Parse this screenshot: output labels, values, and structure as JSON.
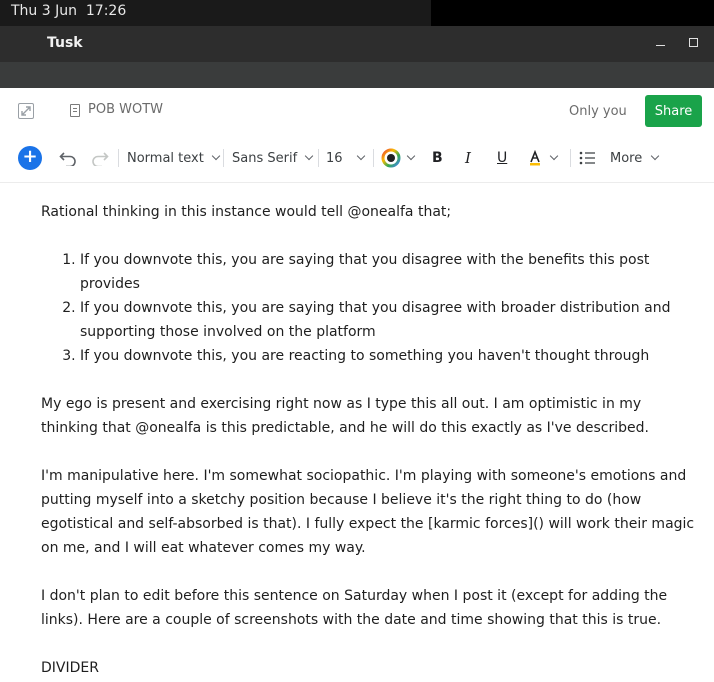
{
  "system": {
    "datetime": "Thu 3 Jun  17:26"
  },
  "window": {
    "title": "Tusk"
  },
  "header": {
    "doc_title": "POB WOTW",
    "visibility": "Only you",
    "share_label": "Share"
  },
  "toolbar": {
    "paragraph_style": "Normal text",
    "font_family": "Sans Serif",
    "font_size": "16",
    "bold": "B",
    "italic": "I",
    "underline": "U",
    "more": "More",
    "accent_color": "#1a73e8"
  },
  "content": {
    "intro": "Rational thinking in this instance would tell @onealfa that;",
    "list": [
      "If you downvote this, you are saying that you disagree with the benefits this post provides",
      "If you downvote this, you are saying that you disagree with broader distribution and supporting those involved on the platform",
      "If you downvote this, you are reacting to something you haven't thought through"
    ],
    "para1": "My ego is present and exercising right now as I type this all out. I am optimistic in my thinking that @onealfa is this predictable, and he will do this exactly as I've described.",
    "para2": "I'm manipulative here. I'm somewhat sociopathic. I'm playing with someone's emotions and putting myself into a sketchy position because I believe it's the right thing to do (how egotistical and self-absorbed is that). I fully expect the [karmic forces]() will work their magic on me, and I will eat whatever comes my way.",
    "para3": "I don't plan to edit before this sentence on Saturday when I post it (except for adding the links). Here are a couple of screenshots with the date and time showing that this is true.",
    "para4": "DIVIDER"
  }
}
